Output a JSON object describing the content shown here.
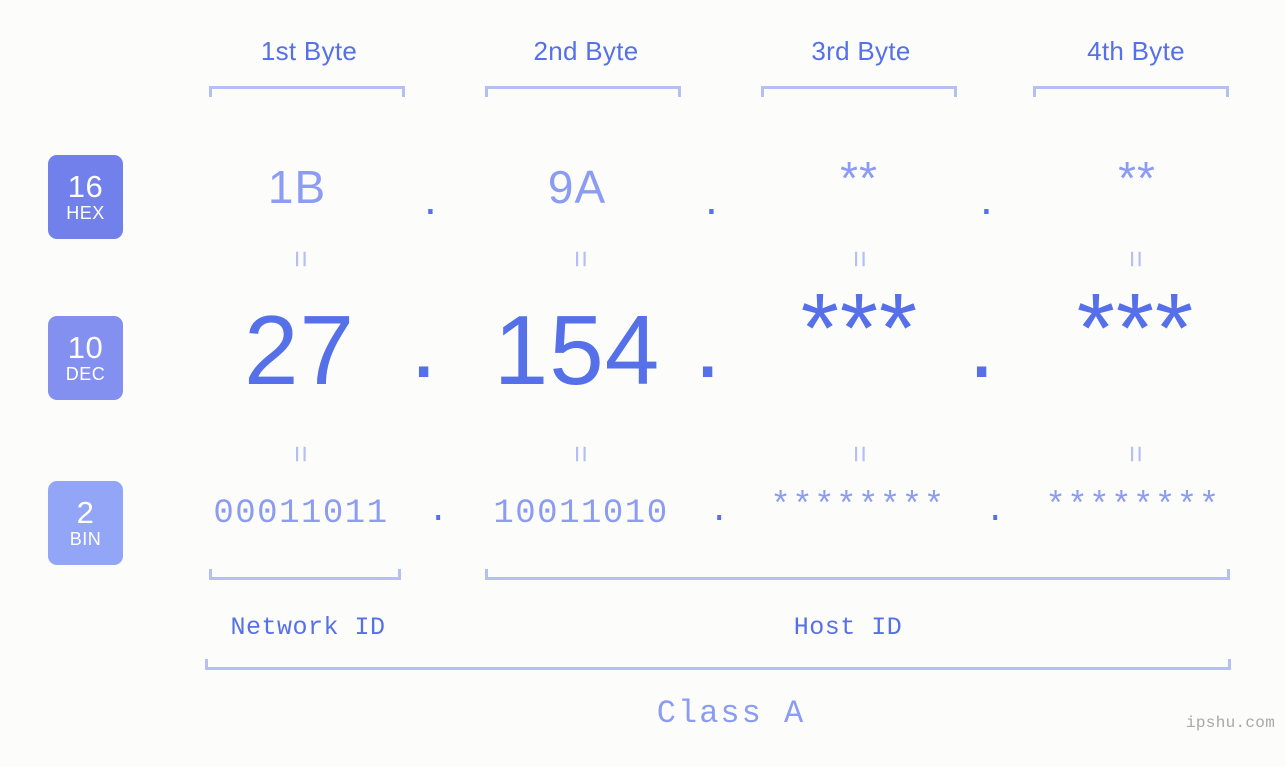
{
  "page": {
    "background_color": "#fcfdfa",
    "accent_color": "#5570e8",
    "muted_accent_color": "#8b9cf2",
    "light_accent_color": "#b4bff5"
  },
  "headers": {
    "bytes": [
      {
        "label": "1st Byte"
      },
      {
        "label": "2nd Byte"
      },
      {
        "label": "3rd Byte"
      },
      {
        "label": "4th Byte"
      }
    ]
  },
  "bases": [
    {
      "id": "hex",
      "number": "16",
      "name": "HEX",
      "color": "#7180ea"
    },
    {
      "id": "dec",
      "number": "10",
      "name": "DEC",
      "color": "#8390ef"
    },
    {
      "id": "bin",
      "number": "2",
      "name": "BIN",
      "color": "#93a5f7"
    }
  ],
  "rows": {
    "hex": {
      "values": [
        "1B",
        "9A",
        "**",
        "**"
      ],
      "separator": "."
    },
    "dec": {
      "values": [
        "27",
        "154",
        "***",
        "***"
      ],
      "separator": "."
    },
    "bin": {
      "values": [
        "00011011",
        "10011010",
        "********",
        "********"
      ],
      "separator": "."
    }
  },
  "connectors": {
    "equals": "=",
    "count_per_gap": 4,
    "gaps": 2
  },
  "sections": [
    {
      "label": "Network ID"
    },
    {
      "label": "Host ID"
    }
  ],
  "class": {
    "label": "Class A"
  },
  "watermark": {
    "text": "ipshu.com"
  }
}
